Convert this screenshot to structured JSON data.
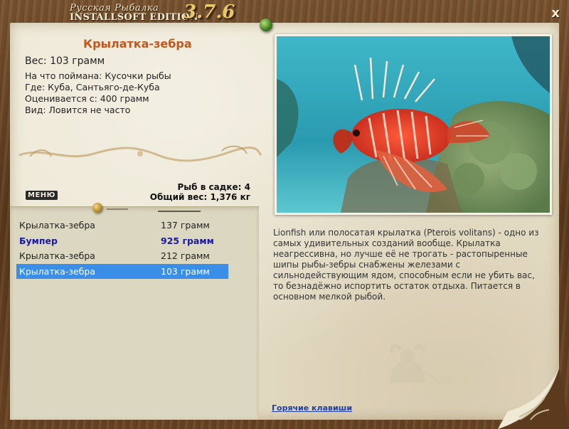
{
  "app": {
    "brand_line1": "Русская Рыбалка",
    "brand_line2": "INSTALLSOFT EDITION",
    "version": "3.7.6",
    "close_label": "x"
  },
  "fish": {
    "title": "Крылатка-зебра",
    "weight": "Вес: 103 грамм",
    "caught_on": "На что поймана: Кусочки рыбы",
    "location": "Где: Куба, Сантьяго-де-Куба",
    "valued_from": "Оценивается с: 400 грамм",
    "kind": "Вид: Ловится не часто"
  },
  "menu": {
    "label": "МЕНЮ"
  },
  "keepnet": {
    "count": "Рыб в садке: 4",
    "total": "Общий вес: 1,376 кг"
  },
  "catch_list": [
    {
      "name": "Крылатка-зебра",
      "weight": "137 грамм",
      "style": "normal"
    },
    {
      "name": "Бумпер",
      "weight": "925 грамм",
      "style": "trophy"
    },
    {
      "name": "Крылатка-зебра",
      "weight": "212 грамм",
      "style": "normal"
    },
    {
      "name": "Крылатка-зебра",
      "weight": "103 грамм",
      "style": "selected"
    }
  ],
  "description": "Lionfish или полосатая крылатка (Pterois volitans) - одно из самых удивительных созданий вообще. Крылатка неагрессивна, но лучше её не трогать - растопыренные шипы рыбы-зебры снабжены железами с сильнодействующим ядом, способным если не убить вас, то безнадёжно испортить остаток отдыха. Питается в основном мелкой рыбой.",
  "footer": {
    "hotkeys_link": "Горячие клавиши"
  },
  "colors": {
    "title": "#c4561b",
    "trophy": "#1a1aa0",
    "selection": "#3a8ee8",
    "link": "#1f3fa8",
    "paper": "#ece6d2",
    "frame": "#6b4524"
  }
}
